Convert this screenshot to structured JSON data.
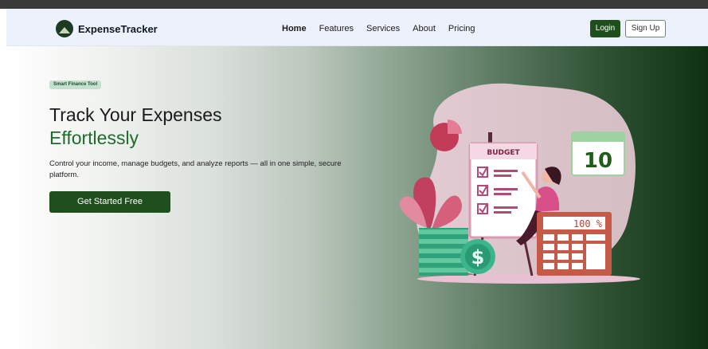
{
  "brand": {
    "name": "ExpenseTracker"
  },
  "nav": {
    "links": [
      "Home",
      "Features",
      "Services",
      "About",
      "Pricing"
    ],
    "login": "Login",
    "signup": "Sign Up"
  },
  "hero": {
    "badge": "Smart Finance Tool",
    "title_line1": "Track Your Expenses",
    "title_line2": "Effortlessly",
    "description": "Control your income, manage budgets, and analyze reports — all in one simple, secure platform.",
    "cta": "Get Started Free"
  },
  "illustration": {
    "board_title": "BUDGET",
    "calendar_number": "10",
    "calculator_display": "100 %",
    "coin_symbol": "$"
  },
  "colors": {
    "accent": "#1f4f1c",
    "accent_text": "#1f6b2d"
  }
}
